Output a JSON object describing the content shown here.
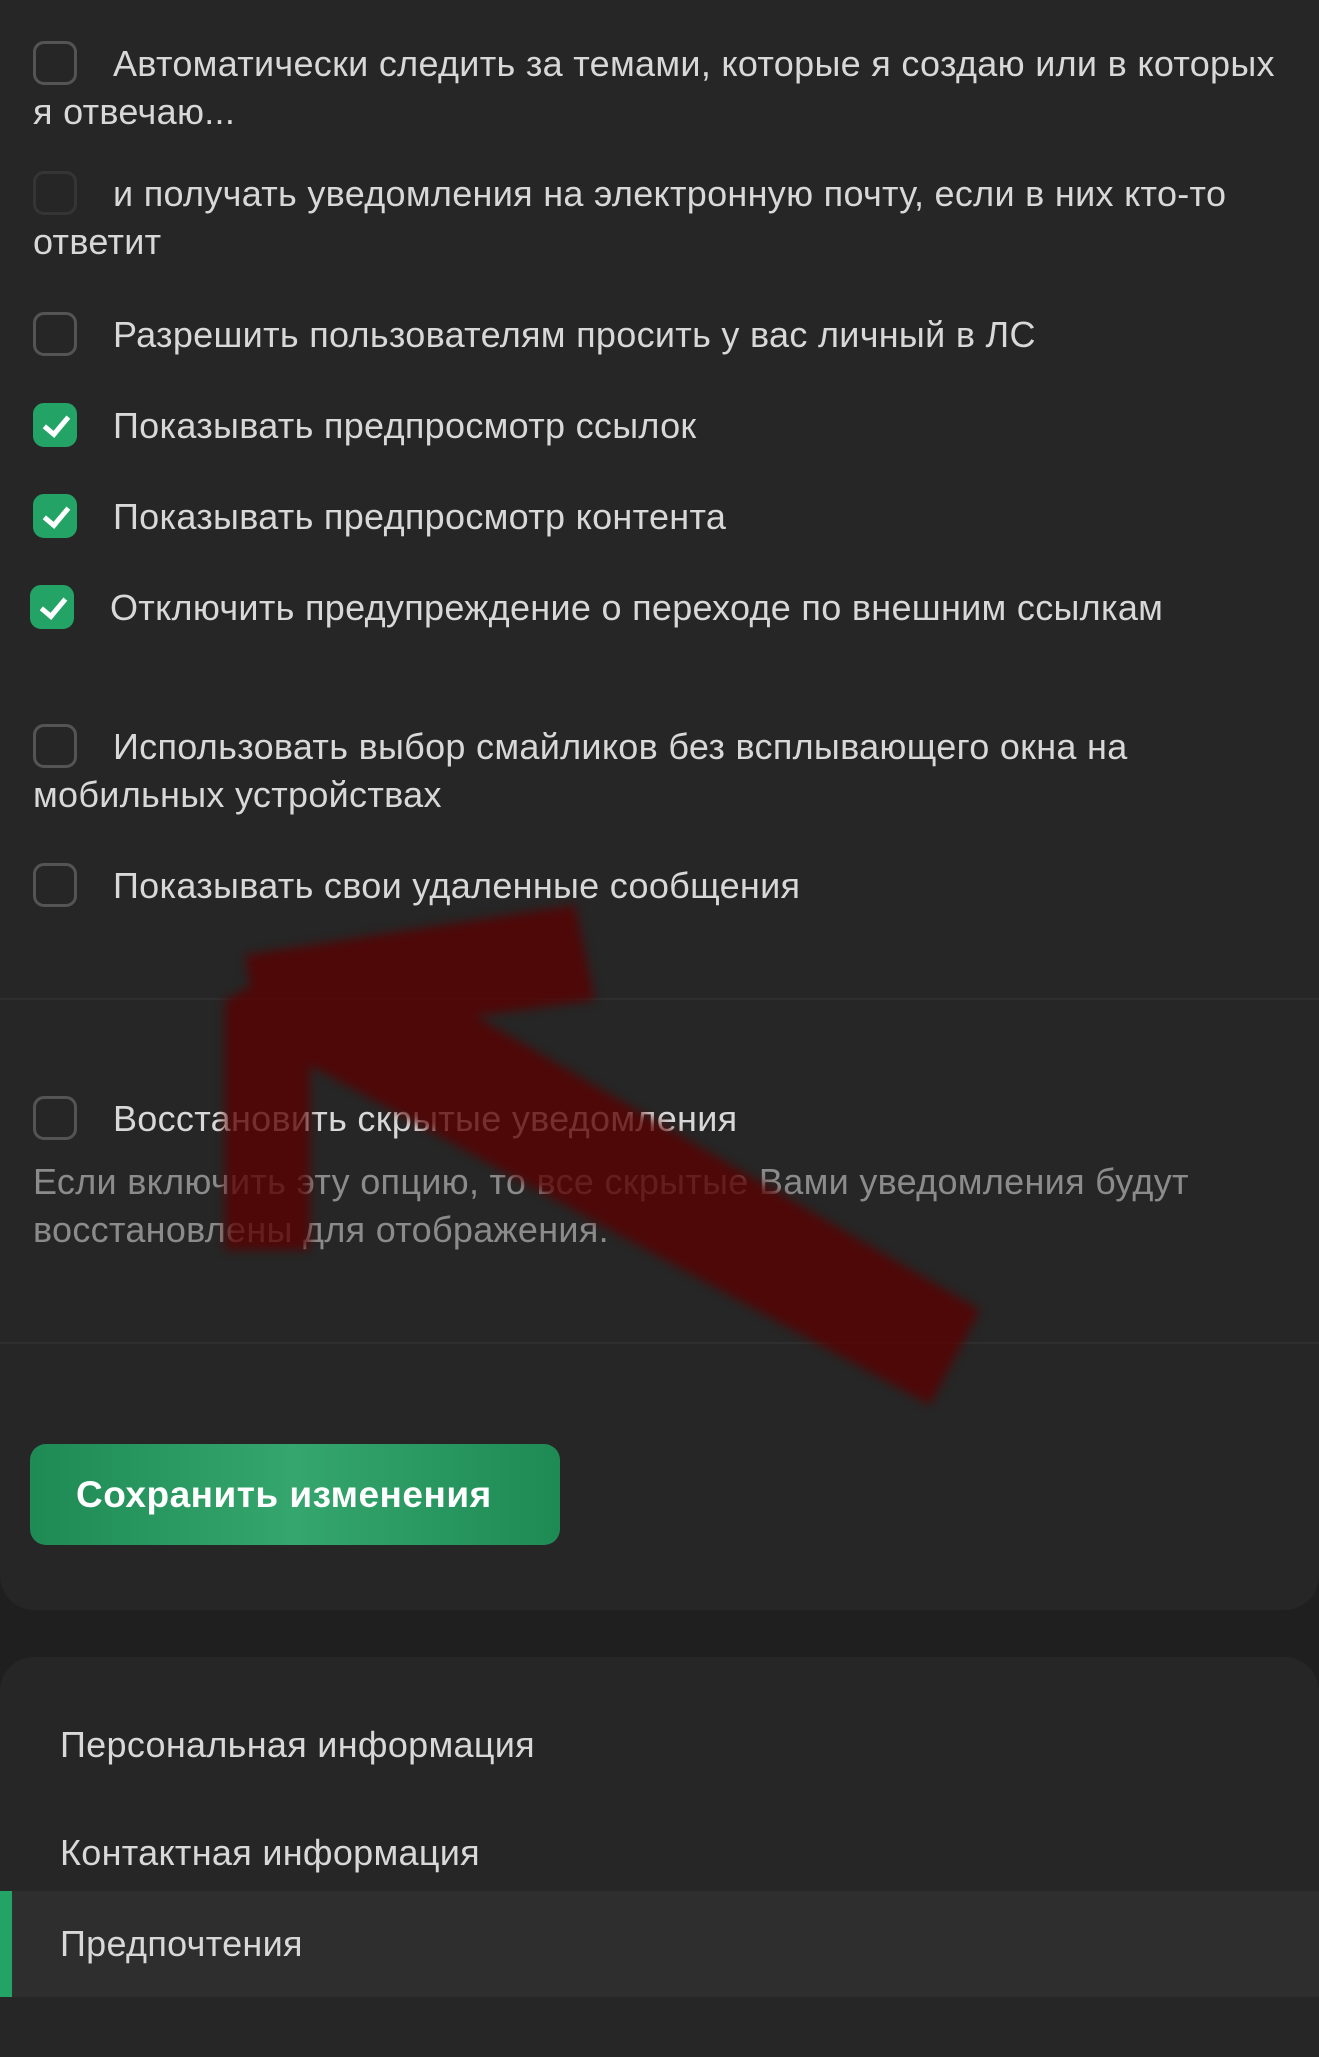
{
  "options": [
    {
      "label": "Автоматически следить за темами, которые я создаю или в которых я отвечаю...",
      "checked": false
    },
    {
      "label": "и получать уведомления на электронную почту, если в них кто-то ответит",
      "checked": false
    },
    {
      "label": "Разрешить пользователям просить у вас личный в ЛС",
      "checked": false
    },
    {
      "label": "Показывать предпросмотр ссылок",
      "checked": true
    },
    {
      "label": "Показывать предпросмотр контента",
      "checked": true
    },
    {
      "label": "Отключить предупреждение о переходе по внешним ссылкам",
      "checked": true
    },
    {
      "label": "Использовать выбор смайликов без всплывающего окна на мобильных устройствах",
      "checked": false
    },
    {
      "label": "Показывать свои удаленные сообщения",
      "checked": false
    }
  ],
  "restore": {
    "label": "Восстановить скрытые уведомления",
    "checked": false,
    "hint": "Если включить эту опцию, то все скрытые Вами уведомления будут восстановлены для отображения."
  },
  "save_button": "Сохранить изменения",
  "nav": {
    "items": [
      {
        "label": "Персональная информация",
        "active": false
      },
      {
        "label": "Контактная информация",
        "active": false
      },
      {
        "label": "Предпочтения",
        "active": true
      }
    ]
  },
  "colors": {
    "background": "#1f1f1f",
    "panel": "#262626",
    "accent": "#23a366",
    "text": "#d8d8d8",
    "hint_text": "#8b8b8b",
    "annotation_arrow": "#5a0600"
  },
  "icons": {
    "checkbox_checked": "check-icon",
    "annotation": "red-arrow-icon"
  }
}
